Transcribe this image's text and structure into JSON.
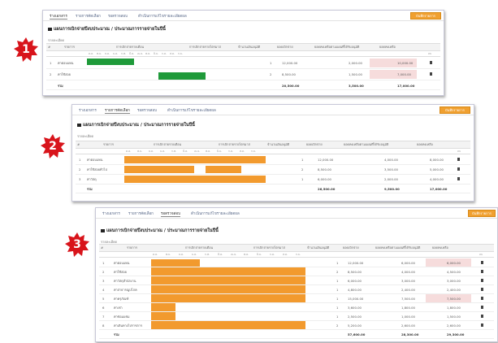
{
  "badges": [
    "1",
    "2",
    "3"
  ],
  "tabs": [
    "ร่างเอกสาร",
    "รายการคัดเลือก",
    "รอตรวจสอบ",
    "ดำเนินการแก้ไขรายละเอียดผล"
  ],
  "action_button": "บันทึกรายการ",
  "title": "แผนการเบิกจ่ายปีงบประมาณ / ประมาณการรายจ่ายในปีนี้",
  "subtitle": "รายละเอียด",
  "columns": [
    "#",
    "รายการ",
    "การเบิกจ่ายรายเดือน",
    "การเบิกจ่ายรายไตรมาส",
    "จำนวนเงินอนุมัติ",
    "ยอดเบิกจ่าย",
    "ยอดคงเหลือตามแผนที่ได้รับอนุมัติ",
    "ยอดคงเหลือ",
    "ลบ"
  ],
  "months": [
    "ต.ค.",
    "พ.ย.",
    "ธ.ค.",
    "ม.ค.",
    "ก.พ.",
    "มี.ค.",
    "เม.ย.",
    "พ.ค.",
    "มิ.ย.",
    "ก.ค.",
    "ส.ค.",
    "ก.ย."
  ],
  "panel1": {
    "rows": [
      {
        "no": "1",
        "name": "ค่าตอบแทน",
        "qty": "1",
        "amount": "12,000.00",
        "spent": "2,000.00",
        "remain": "10,000.00"
      },
      {
        "no": "2",
        "name": "ค่าใช้สอย",
        "qty": "2",
        "amount": "8,500.00",
        "spent": "1,500.00",
        "remain": "7,000.00"
      }
    ],
    "total_label": "รวม",
    "totals": {
      "amount": "20,500.00",
      "spent": "3,500.00",
      "remain": "17,000.00"
    }
  },
  "panel2": {
    "rows": [
      {
        "no": "1",
        "name": "ค่าตอบแทน",
        "qty": "1",
        "amount": "12,000.00",
        "spent": "4,000.00",
        "remain": "8,000.00"
      },
      {
        "no": "2",
        "name": "ค่าใช้สอยทั่วไป",
        "qty": "2",
        "amount": "8,500.00",
        "spent": "3,500.00",
        "remain": "5,000.00"
      },
      {
        "no": "3",
        "name": "ค่าวัสดุ",
        "qty": "1",
        "amount": "6,000.00",
        "spent": "2,000.00",
        "remain": "4,000.00"
      }
    ],
    "total_label": "รวม",
    "totals": {
      "amount": "26,500.00",
      "spent": "9,500.00",
      "remain": "17,000.00"
    }
  },
  "panel3": {
    "rows": [
      {
        "no": "1",
        "name": "ค่าตอบแทน",
        "qty": "1",
        "amount": "12,000.00",
        "spent": "6,000.00",
        "remain": "6,000.00"
      },
      {
        "no": "2",
        "name": "ค่าใช้สอย",
        "qty": "2",
        "amount": "8,500.00",
        "spent": "4,000.00",
        "remain": "4,500.00"
      },
      {
        "no": "3",
        "name": "ค่าวัสดุสำนักงาน",
        "qty": "1",
        "amount": "6,000.00",
        "spent": "3,000.00",
        "remain": "3,000.00"
      },
      {
        "no": "4",
        "name": "ค่าสาธารณูปโภค",
        "qty": "1",
        "amount": "4,800.00",
        "spent": "2,400.00",
        "remain": "2,400.00"
      },
      {
        "no": "5",
        "name": "ค่าครุภัณฑ์",
        "qty": "1",
        "amount": "15,000.00",
        "spent": "7,500.00",
        "remain": "7,500.00"
      },
      {
        "no": "6",
        "name": "ค่าเช่า",
        "qty": "1",
        "amount": "3,600.00",
        "spent": "1,800.00",
        "remain": "1,800.00"
      },
      {
        "no": "7",
        "name": "ค่าซ่อมแซม",
        "qty": "1",
        "amount": "2,500.00",
        "spent": "1,000.00",
        "remain": "1,500.00"
      },
      {
        "no": "8",
        "name": "ค่าเดินทางไปราชการ",
        "qty": "2",
        "amount": "5,200.00",
        "spent": "2,600.00",
        "remain": "2,600.00"
      }
    ],
    "total_label": "รวม",
    "totals": {
      "amount": "57,600.00",
      "spent": "28,300.00",
      "remain": "29,300.00"
    }
  }
}
